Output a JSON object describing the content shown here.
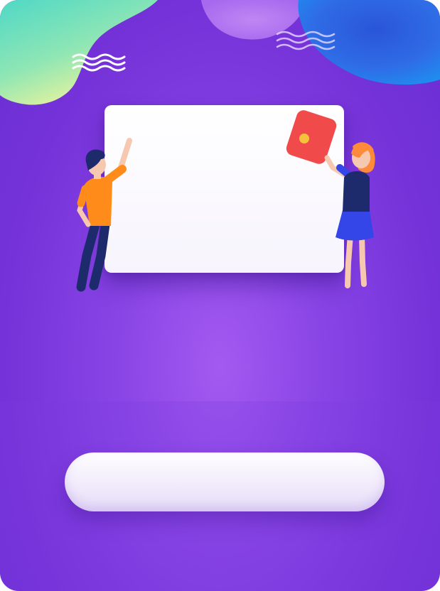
{
  "colors": {
    "background_top": "#6a2fd4",
    "background_center": "#a35af0",
    "blob_teal": "#5fe0c3",
    "blob_yellow": "#f4f59a",
    "blob_blue": "#2f6ce6",
    "blob_pink": "#b87bf2",
    "board": "#ffffff",
    "envelope_red": "#f04a4a",
    "envelope_coin": "#f5c33b",
    "man_shirt": "#ff8c1a",
    "man_pants": "#1d2a6b",
    "woman_hair": "#ff8a3a",
    "woman_skirt": "#3446e8",
    "button": "#f3eefb"
  },
  "illustration": {
    "board": "blank-board",
    "left_person": "man-pointing",
    "right_person": "woman-holding-red-envelope",
    "decoration": [
      "wave-lines-left",
      "wave-lines-right",
      "color-blob-top-left",
      "color-blob-top-right"
    ]
  },
  "action_button": {
    "label": ""
  }
}
